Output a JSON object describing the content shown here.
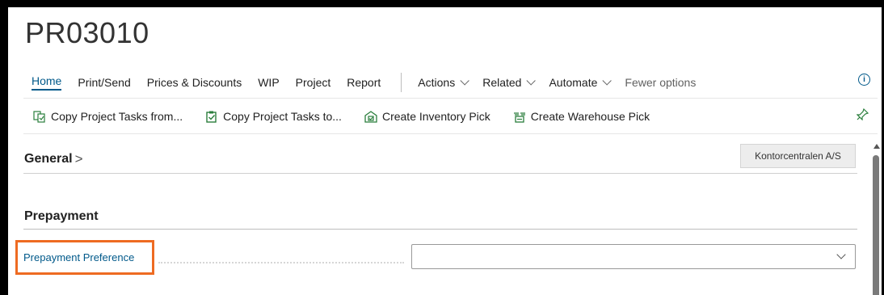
{
  "page_title": "PR03010",
  "tabs": [
    {
      "label": "Home",
      "active": true
    },
    {
      "label": "Print/Send"
    },
    {
      "label": "Prices & Discounts"
    },
    {
      "label": "WIP"
    },
    {
      "label": "Project"
    },
    {
      "label": "Report"
    }
  ],
  "menus": [
    {
      "label": "Actions"
    },
    {
      "label": "Related"
    },
    {
      "label": "Automate"
    }
  ],
  "fewer_options": "Fewer options",
  "actions": [
    {
      "label": "Copy Project Tasks from...",
      "icon": "copy-from-icon"
    },
    {
      "label": "Copy Project Tasks to...",
      "icon": "copy-to-icon"
    },
    {
      "label": "Create Inventory Pick",
      "icon": "inventory-pick-icon"
    },
    {
      "label": "Create Warehouse Pick",
      "icon": "warehouse-pick-icon"
    }
  ],
  "general": {
    "title": "General",
    "gt": ">",
    "badge": "Kontorcentralen A/S"
  },
  "prepayment": {
    "title": "Prepayment",
    "field_label": "Prepayment Preference",
    "field_value": ""
  },
  "colors": {
    "accent": "#00598a",
    "highlight": "#ee6b22",
    "action_icon": "#2a7e3c"
  }
}
